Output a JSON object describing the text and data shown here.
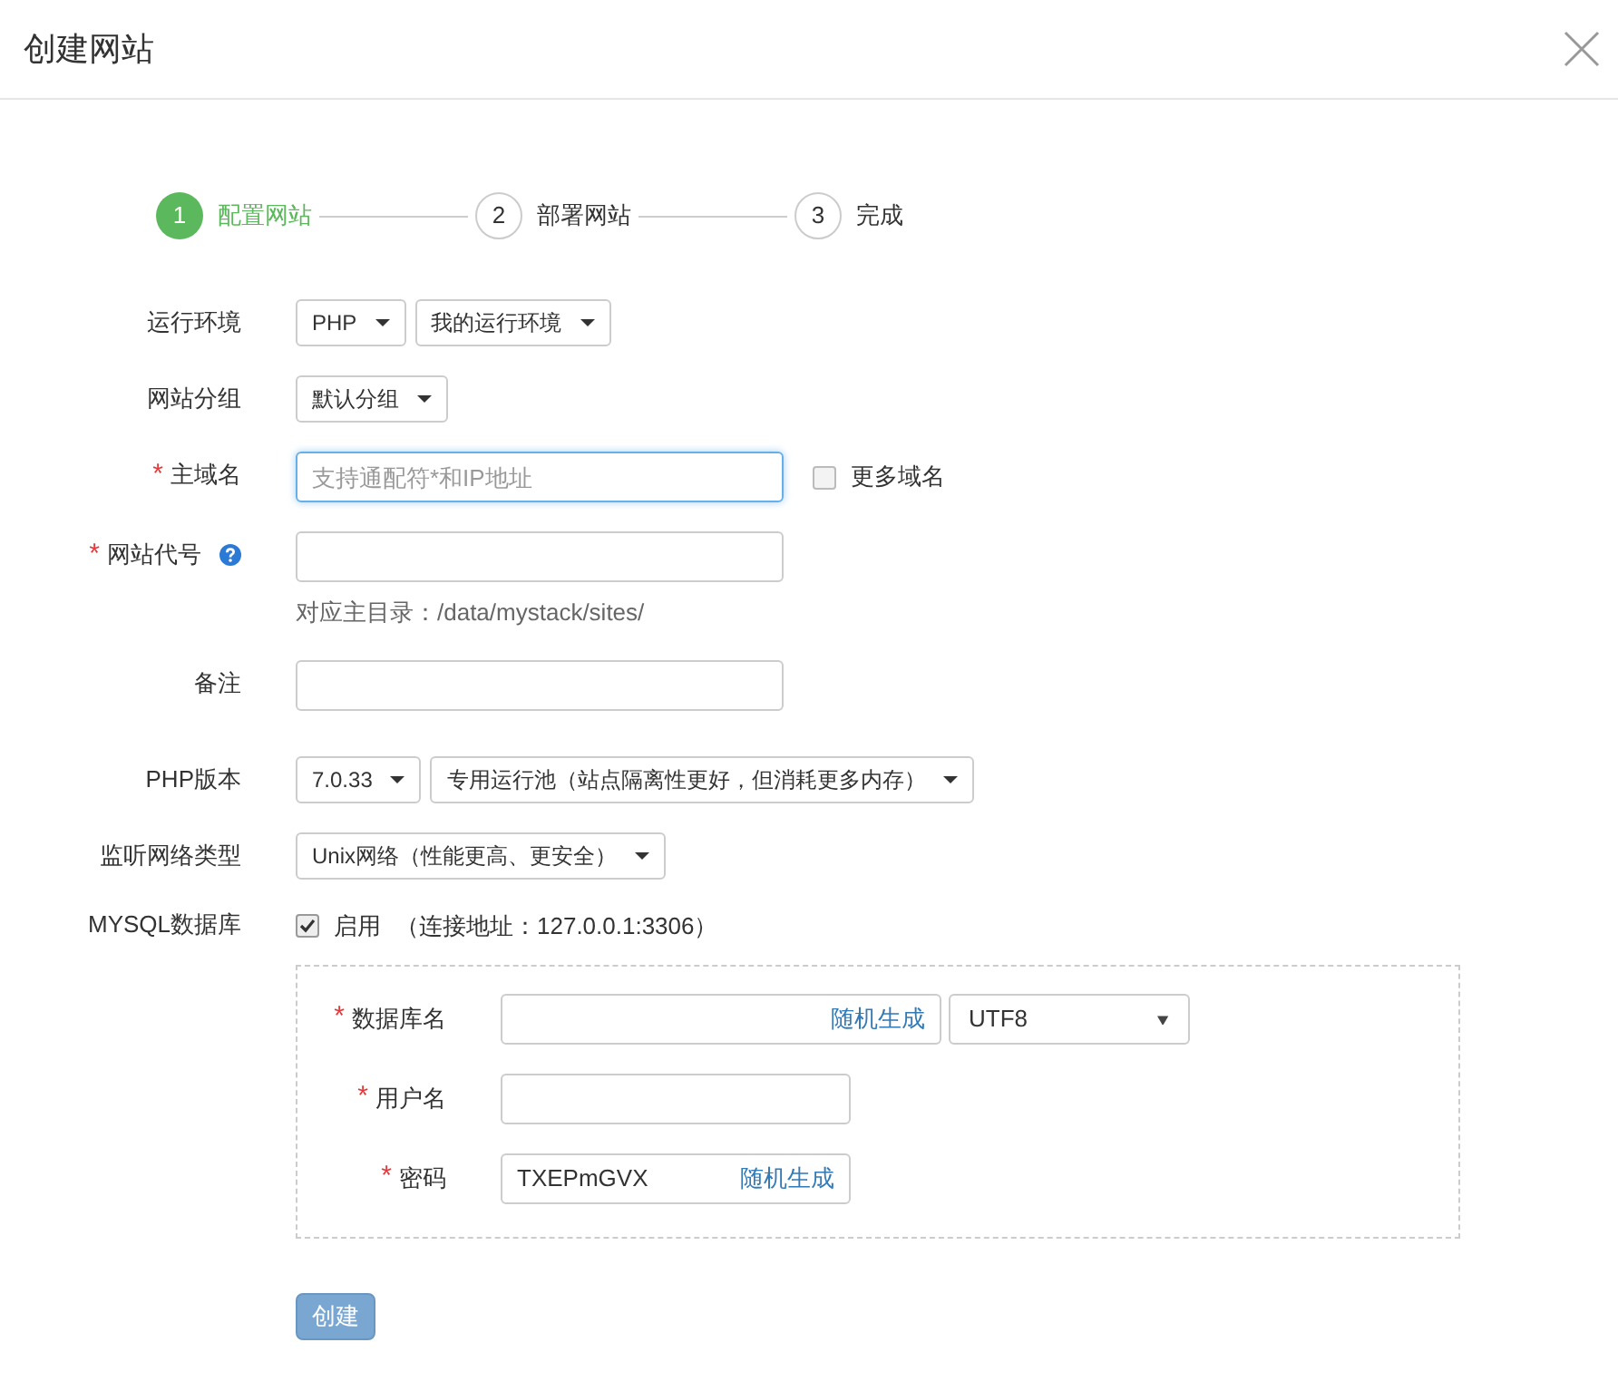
{
  "title": "创建网站",
  "steps": [
    {
      "number": "1",
      "label": "配置网站",
      "selected": true
    },
    {
      "number": "2",
      "label": "部署网站",
      "selected": false
    },
    {
      "number": "3",
      "label": "完成",
      "selected": false
    }
  ],
  "form": [
    {
      "label": "运行环境",
      "kind": "selects",
      "selects": [
        "PHP",
        "我的运行环境"
      ]
    },
    {
      "label": "网站分组",
      "kind": "selects",
      "selects": [
        "默认分组"
      ]
    },
    {
      "label": "主域名",
      "required_mark": "*",
      "kind": "input",
      "placeholder": "支持通配符*和IP地址",
      "focused": true,
      "checkbox": {
        "label": "更多域名",
        "checked": false
      }
    },
    {
      "label": "网站代号",
      "required_mark": "*",
      "help": true,
      "kind": "input",
      "focused": false,
      "hint": "对应主目录：/data/mystack/sites/"
    },
    {
      "label": "备注",
      "kind": "input",
      "focused": false
    },
    {
      "label": "PHP版本",
      "kind": "selects",
      "selects": [
        "7.0.33",
        "专用运行池（站点隔离性更好，但消耗更多内存）"
      ]
    },
    {
      "label": "监听网络类型",
      "kind": "selects",
      "selects": [
        "Unix网络（性能更高、更安全）"
      ]
    },
    {
      "label": "MYSQL数据库",
      "kind": "checkbox",
      "checkbox": {
        "label": "启用",
        "checked": true
      },
      "note": "（连接地址：127.0.0.1:3306）"
    }
  ],
  "mysql": [
    {
      "label": "数据库名",
      "required_mark": "*",
      "action": "随机生成",
      "charset": "UTF8"
    },
    {
      "label": "用户名",
      "required_mark": "*"
    },
    {
      "label": "密码",
      "required_mark": "*",
      "value": "TXEPmGVX",
      "action": "随机生成"
    }
  ],
  "submit": {
    "label": "创建",
    "disabled": true
  }
}
